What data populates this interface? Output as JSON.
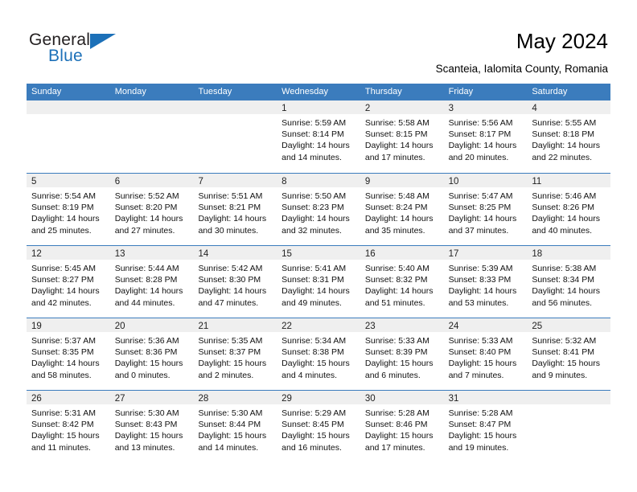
{
  "brand": {
    "name_part1": "General",
    "name_part2": "Blue"
  },
  "header": {
    "title": "May 2024",
    "subtitle": "Scanteia, Ialomita County, Romania"
  },
  "colors": {
    "header_blue": "#3b7cbd",
    "brand_blue": "#1c70b8",
    "daynum_band": "#efefef"
  },
  "calendar": {
    "weekday_headers": [
      "Sunday",
      "Monday",
      "Tuesday",
      "Wednesday",
      "Thursday",
      "Friday",
      "Saturday"
    ],
    "weeks": [
      [
        {
          "day": "",
          "empty": true,
          "sunrise": "",
          "sunset": "",
          "daylight_line1": "",
          "daylight_line2": ""
        },
        {
          "day": "",
          "empty": true,
          "sunrise": "",
          "sunset": "",
          "daylight_line1": "",
          "daylight_line2": ""
        },
        {
          "day": "",
          "empty": true,
          "sunrise": "",
          "sunset": "",
          "daylight_line1": "",
          "daylight_line2": ""
        },
        {
          "day": "1",
          "empty": false,
          "sunrise": "Sunrise: 5:59 AM",
          "sunset": "Sunset: 8:14 PM",
          "daylight_line1": "Daylight: 14 hours",
          "daylight_line2": "and 14 minutes."
        },
        {
          "day": "2",
          "empty": false,
          "sunrise": "Sunrise: 5:58 AM",
          "sunset": "Sunset: 8:15 PM",
          "daylight_line1": "Daylight: 14 hours",
          "daylight_line2": "and 17 minutes."
        },
        {
          "day": "3",
          "empty": false,
          "sunrise": "Sunrise: 5:56 AM",
          "sunset": "Sunset: 8:17 PM",
          "daylight_line1": "Daylight: 14 hours",
          "daylight_line2": "and 20 minutes."
        },
        {
          "day": "4",
          "empty": false,
          "sunrise": "Sunrise: 5:55 AM",
          "sunset": "Sunset: 8:18 PM",
          "daylight_line1": "Daylight: 14 hours",
          "daylight_line2": "and 22 minutes."
        }
      ],
      [
        {
          "day": "5",
          "empty": false,
          "sunrise": "Sunrise: 5:54 AM",
          "sunset": "Sunset: 8:19 PM",
          "daylight_line1": "Daylight: 14 hours",
          "daylight_line2": "and 25 minutes."
        },
        {
          "day": "6",
          "empty": false,
          "sunrise": "Sunrise: 5:52 AM",
          "sunset": "Sunset: 8:20 PM",
          "daylight_line1": "Daylight: 14 hours",
          "daylight_line2": "and 27 minutes."
        },
        {
          "day": "7",
          "empty": false,
          "sunrise": "Sunrise: 5:51 AM",
          "sunset": "Sunset: 8:21 PM",
          "daylight_line1": "Daylight: 14 hours",
          "daylight_line2": "and 30 minutes."
        },
        {
          "day": "8",
          "empty": false,
          "sunrise": "Sunrise: 5:50 AM",
          "sunset": "Sunset: 8:23 PM",
          "daylight_line1": "Daylight: 14 hours",
          "daylight_line2": "and 32 minutes."
        },
        {
          "day": "9",
          "empty": false,
          "sunrise": "Sunrise: 5:48 AM",
          "sunset": "Sunset: 8:24 PM",
          "daylight_line1": "Daylight: 14 hours",
          "daylight_line2": "and 35 minutes."
        },
        {
          "day": "10",
          "empty": false,
          "sunrise": "Sunrise: 5:47 AM",
          "sunset": "Sunset: 8:25 PM",
          "daylight_line1": "Daylight: 14 hours",
          "daylight_line2": "and 37 minutes."
        },
        {
          "day": "11",
          "empty": false,
          "sunrise": "Sunrise: 5:46 AM",
          "sunset": "Sunset: 8:26 PM",
          "daylight_line1": "Daylight: 14 hours",
          "daylight_line2": "and 40 minutes."
        }
      ],
      [
        {
          "day": "12",
          "empty": false,
          "sunrise": "Sunrise: 5:45 AM",
          "sunset": "Sunset: 8:27 PM",
          "daylight_line1": "Daylight: 14 hours",
          "daylight_line2": "and 42 minutes."
        },
        {
          "day": "13",
          "empty": false,
          "sunrise": "Sunrise: 5:44 AM",
          "sunset": "Sunset: 8:28 PM",
          "daylight_line1": "Daylight: 14 hours",
          "daylight_line2": "and 44 minutes."
        },
        {
          "day": "14",
          "empty": false,
          "sunrise": "Sunrise: 5:42 AM",
          "sunset": "Sunset: 8:30 PM",
          "daylight_line1": "Daylight: 14 hours",
          "daylight_line2": "and 47 minutes."
        },
        {
          "day": "15",
          "empty": false,
          "sunrise": "Sunrise: 5:41 AM",
          "sunset": "Sunset: 8:31 PM",
          "daylight_line1": "Daylight: 14 hours",
          "daylight_line2": "and 49 minutes."
        },
        {
          "day": "16",
          "empty": false,
          "sunrise": "Sunrise: 5:40 AM",
          "sunset": "Sunset: 8:32 PM",
          "daylight_line1": "Daylight: 14 hours",
          "daylight_line2": "and 51 minutes."
        },
        {
          "day": "17",
          "empty": false,
          "sunrise": "Sunrise: 5:39 AM",
          "sunset": "Sunset: 8:33 PM",
          "daylight_line1": "Daylight: 14 hours",
          "daylight_line2": "and 53 minutes."
        },
        {
          "day": "18",
          "empty": false,
          "sunrise": "Sunrise: 5:38 AM",
          "sunset": "Sunset: 8:34 PM",
          "daylight_line1": "Daylight: 14 hours",
          "daylight_line2": "and 56 minutes."
        }
      ],
      [
        {
          "day": "19",
          "empty": false,
          "sunrise": "Sunrise: 5:37 AM",
          "sunset": "Sunset: 8:35 PM",
          "daylight_line1": "Daylight: 14 hours",
          "daylight_line2": "and 58 minutes."
        },
        {
          "day": "20",
          "empty": false,
          "sunrise": "Sunrise: 5:36 AM",
          "sunset": "Sunset: 8:36 PM",
          "daylight_line1": "Daylight: 15 hours",
          "daylight_line2": "and 0 minutes."
        },
        {
          "day": "21",
          "empty": false,
          "sunrise": "Sunrise: 5:35 AM",
          "sunset": "Sunset: 8:37 PM",
          "daylight_line1": "Daylight: 15 hours",
          "daylight_line2": "and 2 minutes."
        },
        {
          "day": "22",
          "empty": false,
          "sunrise": "Sunrise: 5:34 AM",
          "sunset": "Sunset: 8:38 PM",
          "daylight_line1": "Daylight: 15 hours",
          "daylight_line2": "and 4 minutes."
        },
        {
          "day": "23",
          "empty": false,
          "sunrise": "Sunrise: 5:33 AM",
          "sunset": "Sunset: 8:39 PM",
          "daylight_line1": "Daylight: 15 hours",
          "daylight_line2": "and 6 minutes."
        },
        {
          "day": "24",
          "empty": false,
          "sunrise": "Sunrise: 5:33 AM",
          "sunset": "Sunset: 8:40 PM",
          "daylight_line1": "Daylight: 15 hours",
          "daylight_line2": "and 7 minutes."
        },
        {
          "day": "25",
          "empty": false,
          "sunrise": "Sunrise: 5:32 AM",
          "sunset": "Sunset: 8:41 PM",
          "daylight_line1": "Daylight: 15 hours",
          "daylight_line2": "and 9 minutes."
        }
      ],
      [
        {
          "day": "26",
          "empty": false,
          "sunrise": "Sunrise: 5:31 AM",
          "sunset": "Sunset: 8:42 PM",
          "daylight_line1": "Daylight: 15 hours",
          "daylight_line2": "and 11 minutes."
        },
        {
          "day": "27",
          "empty": false,
          "sunrise": "Sunrise: 5:30 AM",
          "sunset": "Sunset: 8:43 PM",
          "daylight_line1": "Daylight: 15 hours",
          "daylight_line2": "and 13 minutes."
        },
        {
          "day": "28",
          "empty": false,
          "sunrise": "Sunrise: 5:30 AM",
          "sunset": "Sunset: 8:44 PM",
          "daylight_line1": "Daylight: 15 hours",
          "daylight_line2": "and 14 minutes."
        },
        {
          "day": "29",
          "empty": false,
          "sunrise": "Sunrise: 5:29 AM",
          "sunset": "Sunset: 8:45 PM",
          "daylight_line1": "Daylight: 15 hours",
          "daylight_line2": "and 16 minutes."
        },
        {
          "day": "30",
          "empty": false,
          "sunrise": "Sunrise: 5:28 AM",
          "sunset": "Sunset: 8:46 PM",
          "daylight_line1": "Daylight: 15 hours",
          "daylight_line2": "and 17 minutes."
        },
        {
          "day": "31",
          "empty": false,
          "sunrise": "Sunrise: 5:28 AM",
          "sunset": "Sunset: 8:47 PM",
          "daylight_line1": "Daylight: 15 hours",
          "daylight_line2": "and 19 minutes."
        },
        {
          "day": "",
          "empty": true,
          "sunrise": "",
          "sunset": "",
          "daylight_line1": "",
          "daylight_line2": ""
        }
      ]
    ]
  }
}
